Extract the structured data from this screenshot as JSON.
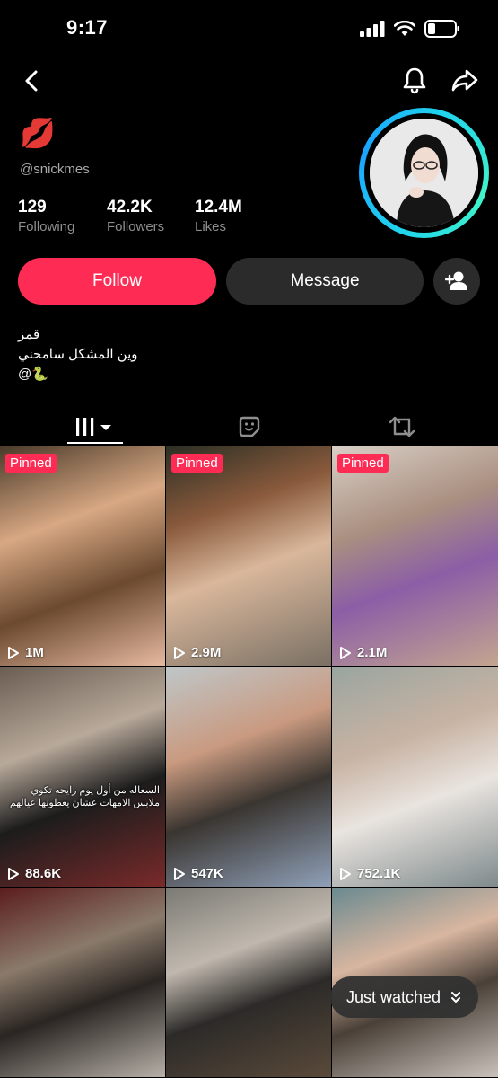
{
  "status_bar": {
    "time": "9:17"
  },
  "profile": {
    "name_emoji": "💋",
    "username": "@snickmes",
    "stats": [
      {
        "value": "129",
        "label": "Following"
      },
      {
        "value": "42.2K",
        "label": "Followers"
      },
      {
        "value": "12.4M",
        "label": "Likes"
      }
    ],
    "bio": [
      "قمر",
      "وين المشكل سامحني",
      "@🐍"
    ]
  },
  "actions": {
    "follow": "Follow",
    "message": "Message"
  },
  "videos": [
    {
      "pinned": "Pinned",
      "views": "1M",
      "bg": "linear-gradient(160deg,#4a3a2a 0%,#d8a883 35%,#6b4a30 65%,#e6b9a0 100%)"
    },
    {
      "pinned": "Pinned",
      "views": "2.9M",
      "bg": "linear-gradient(160deg,#2b2f24 0%,#8a5a3c 30%,#d9b79b 55%,#7a7064 100%)"
    },
    {
      "pinned": "Pinned",
      "views": "2.1M",
      "bg": "linear-gradient(160deg,#d9cfc6 0%,#a98f80 35%,#8b5ea6 60%,#c3a58f 100%)"
    },
    {
      "views": "88.6K",
      "caption": "السعاله من أول يوم رايحه تكوي ملابس الامهات عشان يعطونها عيالهم",
      "bg": "linear-gradient(160deg,#6a5d52 0%,#b8a99a 35%,#1c1c1c 60%,#7a2a2a 100%)"
    },
    {
      "views": "547K",
      "bg": "linear-gradient(160deg,#bfc6c8 0%,#c99a80 35%,#3a3530 60%,#8fa0b8 100%)"
    },
    {
      "views": "752.1K",
      "bg": "linear-gradient(160deg,#9aa5a0 0%,#c8b3a3 35%,#e9e4df 60%,#7f8a8c 100%)"
    },
    {
      "views": "",
      "bg": "linear-gradient(160deg,#5b1e1e 0%,#8a7a6a 35%,#2a2522 60%,#b7b0a8 100%)"
    },
    {
      "views": "",
      "bg": "linear-gradient(160deg,#7b7a74 0%,#c0b8ae 35%,#2c2a28 60%,#5a4a3a 100%)"
    },
    {
      "views": "",
      "bg": "linear-gradient(160deg,#6b8a90 0%,#d8b6a0 35%,#4a4038 60%,#c9c2bb 100%)"
    }
  ],
  "just_watched": "Just watched"
}
